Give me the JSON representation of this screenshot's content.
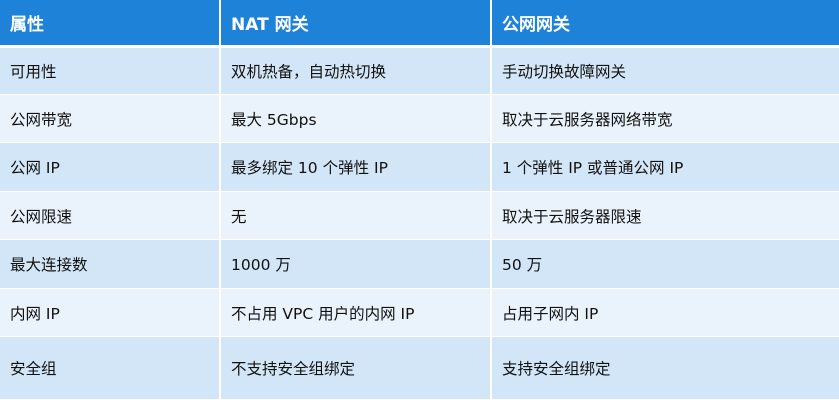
{
  "table": {
    "headers": [
      "属性",
      "NAT 网关",
      "公网网关"
    ],
    "rows": [
      [
        "可用性",
        "双机热备，自动热切换",
        "手动切换故障网关"
      ],
      [
        "公网带宽",
        "最大 5Gbps",
        "取决于云服务器网络带宽"
      ],
      [
        "公网 IP",
        "最多绑定 10 个弹性 IP",
        "1 个弹性 IP 或普通公网 IP"
      ],
      [
        "公网限速",
        "无",
        "取决于云服务器限速"
      ],
      [
        "最大连接数",
        "1000 万",
        "50 万"
      ],
      [
        "内网 IP",
        "不占用 VPC 用户的内网 IP",
        "占用子网内 IP"
      ],
      [
        "安全组",
        "不支持安全组绑定",
        "支持安全组绑定"
      ]
    ]
  },
  "colors": {
    "header_bg": "#1e82d8",
    "row_odd": "#d3e6f7",
    "row_even": "#eaf2fb"
  }
}
